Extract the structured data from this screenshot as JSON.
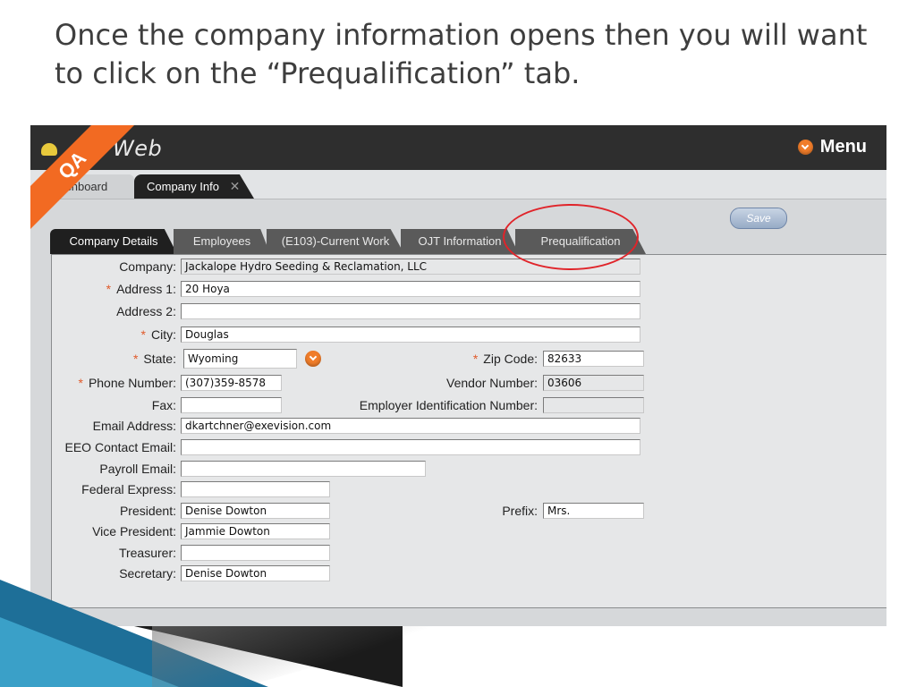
{
  "slide": {
    "title": "Once the company information opens then you will want to click on the “Prequalification” tab."
  },
  "app": {
    "logo_text": "Web",
    "ribbon_text": "QA",
    "menu_label": "Menu"
  },
  "top_tabs": [
    {
      "label": "ashboard"
    },
    {
      "label": "Company Info"
    }
  ],
  "close_glyph": "✕",
  "toolbar": {
    "save_label": "Save"
  },
  "subtabs": [
    {
      "label": "Company Details"
    },
    {
      "label": "Employees"
    },
    {
      "label": "(E103)-Current Work"
    },
    {
      "label": "OJT Information"
    },
    {
      "label": "Prequalification"
    }
  ],
  "form": {
    "required_mark": "*",
    "company": {
      "label": "Company:",
      "value": "Jackalope Hydro Seeding & Reclamation, LLC"
    },
    "address1": {
      "label": "Address 1:",
      "value": "20 Hoya"
    },
    "address2": {
      "label": "Address 2:",
      "value": ""
    },
    "city": {
      "label": "City:",
      "value": "Douglas"
    },
    "state": {
      "label": "State:",
      "value": "Wyoming"
    },
    "zip": {
      "label": "Zip Code:",
      "value": "82633"
    },
    "phone": {
      "label": "Phone Number:",
      "value": "(307)359-8578"
    },
    "vendor": {
      "label": "Vendor Number:",
      "value": "03606"
    },
    "fax": {
      "label": "Fax:",
      "value": ""
    },
    "ein": {
      "label": "Employer Identification Number:",
      "value": ""
    },
    "email": {
      "label": "Email Address:",
      "value": "dkartchner@exevision.com"
    },
    "eeo_email": {
      "label": "EEO Contact Email:",
      "value": ""
    },
    "payroll_email": {
      "label": "Payroll Email:",
      "value": ""
    },
    "fedex": {
      "label": "Federal Express:",
      "value": ""
    },
    "president": {
      "label": "President:",
      "value": "Denise Dowton"
    },
    "prefix": {
      "label": "Prefix:",
      "value": "Mrs."
    },
    "vice_president": {
      "label": "Vice President:",
      "value": "Jammie Dowton"
    },
    "treasurer": {
      "label": "Treasurer:",
      "value": ""
    },
    "secretary": {
      "label": "Secretary:",
      "value": "Denise Dowton"
    }
  },
  "colors": {
    "accent_orange": "#f07d2a",
    "header_dark": "#2e2e2e",
    "highlight_red": "#e0242a",
    "required_star": "#e05a2a"
  }
}
